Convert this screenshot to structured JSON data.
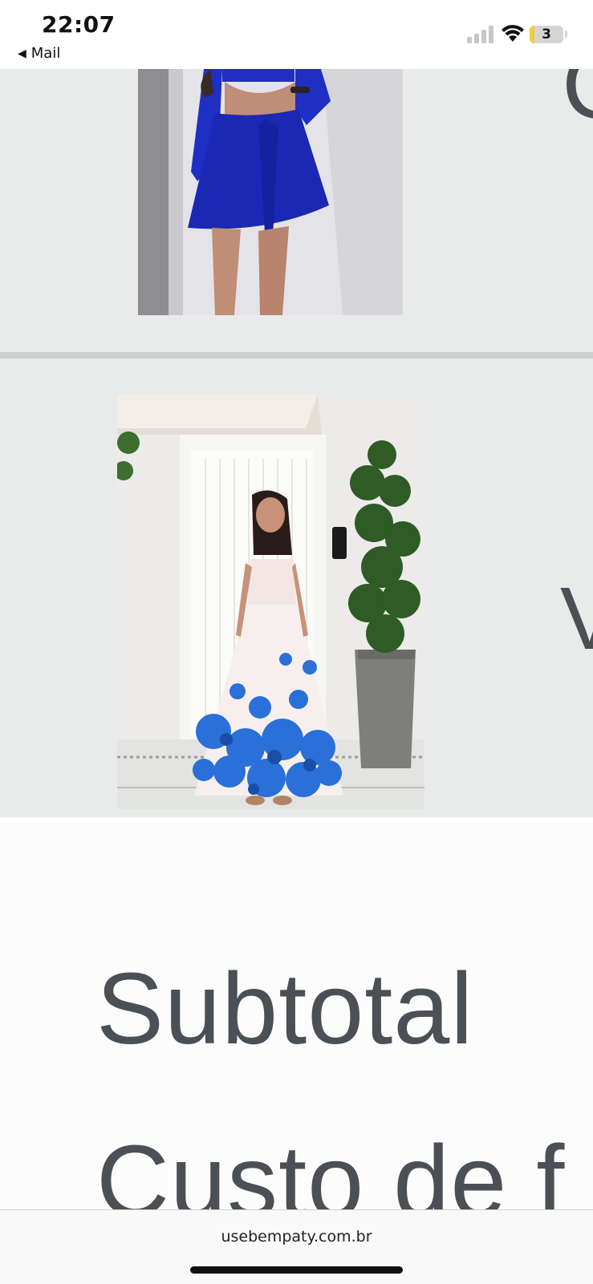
{
  "status_bar": {
    "time": "22:07",
    "back_label": "Mail",
    "battery_level": "3",
    "icons": [
      "signal-icon",
      "wifi-icon",
      "battery-icon"
    ]
  },
  "cart_items": [
    {
      "image_description_icon": "product-photo-blue-outfit",
      "colors": {
        "garment": "#1f2fc4"
      }
    },
    {
      "image_description_icon": "product-photo-floral-dress",
      "colors": {
        "garment": "#2b6fd8"
      }
    }
  ],
  "partial_labels": {
    "item1_edge": "C",
    "item2_edge": "V"
  },
  "summary": {
    "subtotal_label": "Subtotal",
    "shipping_label": "Custo de f"
  },
  "browser": {
    "url": "usebempaty.com.br"
  },
  "colors": {
    "text": "#4b4f56",
    "item_background": "#e9ebeb",
    "divider": "#cfd1d1"
  }
}
